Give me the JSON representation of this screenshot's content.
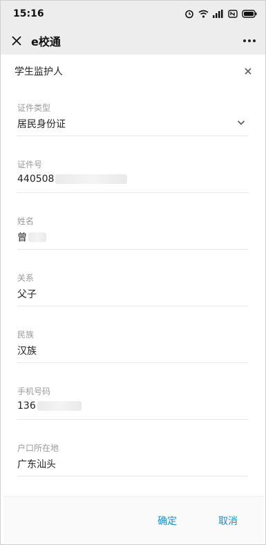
{
  "status": {
    "time": "15:16"
  },
  "appbar": {
    "title": "e校通"
  },
  "dialog": {
    "title": "学生监护人",
    "fields": [
      {
        "label": "证件类型",
        "value": "居民身份证"
      },
      {
        "label": "证件号",
        "value": "440508"
      },
      {
        "label": "姓名",
        "value": "曾"
      },
      {
        "label": "关系",
        "value": "父子"
      },
      {
        "label": "民族",
        "value": "汉族"
      },
      {
        "label": "手机号码",
        "value": "136"
      },
      {
        "label": "户口所在地",
        "value": "广东汕头"
      }
    ],
    "confirm_label": "确定",
    "cancel_label": "取消"
  },
  "colors": {
    "accent": "#1a8cd8",
    "bar_bg": "#ededed"
  },
  "icons": [
    "alarm-icon",
    "wifi-icon",
    "signal-icon",
    "nfc-icon",
    "battery-icon",
    "close-icon",
    "more-icon",
    "chevron-down-icon"
  ]
}
